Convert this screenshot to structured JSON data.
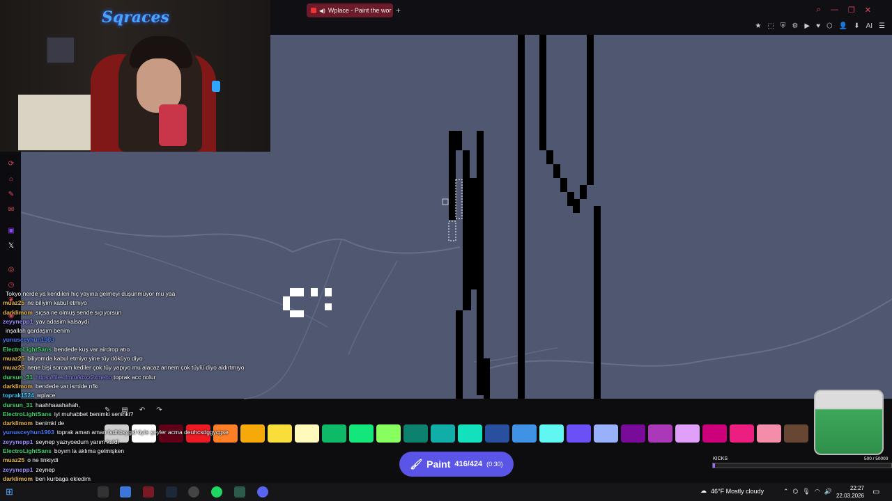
{
  "browser": {
    "tab_title": "Wplace - Paint the wor",
    "new_tab": "+",
    "window_controls": [
      "⌕",
      "—",
      "❐",
      "✕"
    ],
    "toolbar_icons": [
      "★",
      "⬚",
      "⛨",
      "⚙",
      "▶",
      "♥",
      "⬡",
      "👤",
      "⬇",
      "AI",
      "☰"
    ]
  },
  "webcam": {
    "logo_text": "Sqraces"
  },
  "chat": {
    "messages": [
      {
        "user": "",
        "text": "Tokyo nerde ya kendileri hiç yayına gelmeyi düşünmüyor mu yaa",
        "user_color": "#e04b5b"
      },
      {
        "user": "muaz25",
        "text": "ne biliyim kabul etmiyo",
        "user_color": "#e8b84a"
      },
      {
        "user": "darklimom",
        "text": "sıçsa ne olmuş sende sıçıyorsun",
        "user_color": "#e8b84a"
      },
      {
        "user": "zeyynepp1",
        "text": "yav adasim kalsaydi",
        "user_color": "#9b8cff"
      },
      {
        "user": "",
        "text": "inşallah gardaşım benim",
        "user_color": "#e04b5b"
      },
      {
        "user": "yunusceyhun1903",
        "text": "",
        "user_color": "#4a7dff"
      },
      {
        "user": "ElectroLightSans",
        "text": "bendede kuş var airdrop atıo",
        "user_color": "#3cd66a"
      },
      {
        "user": "muaz25",
        "text": "biliyomda kabul etmiyo yine tüy döküyo diyo",
        "user_color": "#e8b84a"
      },
      {
        "user": "muaz25",
        "text": "nene bişi sorcam kediler çok tüy yapıyo mu alacaz annem çok tüylü diyo aldırtmıyo",
        "user_color": "#e8b84a"
      },
      {
        "user": "dursun_31",
        "text": "toprak acc nolur",
        "link": "https://files.fm/u/kbxz2xmeho",
        "user_color": "#3cd66a"
      },
      {
        "user": "darklimom",
        "text": "bendede var ismide rıfkı",
        "user_color": "#e8b84a"
      },
      {
        "user": "toprak1524",
        "text": "wplace",
        "user_color": "#3cc8ff"
      },
      {
        "user": "dursun_31",
        "text": "haahhaaahahah,",
        "user_color": "#3cd66a"
      },
      {
        "user": "ElectroLightSans",
        "text": "iyi muhabbet benimki seninki?",
        "user_color": "#3cd66a"
      },
      {
        "user": "darklimom",
        "text": "benimki de",
        "user_color": "#e8b84a"
      },
      {
        "user": "yunusceyhun1903",
        "text": "toprak aman aman fsdhbsygsf öyle şeyler acma deuhcsdggycgse",
        "user_color": "#4a7dff"
      },
      {
        "user": "zeyynepp1",
        "text": "seynep yazıyoedum yarım kaldi",
        "user_color": "#9b8cff"
      },
      {
        "user": "ElectroLightSans",
        "text": "boyım la aklıma gelmişken",
        "user_color": "#3cd66a"
      },
      {
        "user": "muaz25",
        "text": "o ne linkiydi",
        "user_color": "#e8b84a"
      },
      {
        "user": "zeyynepp1",
        "text": "zeynep",
        "user_color": "#9b8cff"
      },
      {
        "user": "darklimom",
        "text": "ben kurbaga ekledim",
        "user_color": "#e8b84a"
      }
    ]
  },
  "paint_tools": [
    "✎",
    "▤",
    "↶",
    "↷"
  ],
  "palette": {
    "colors": [
      "#cfcfcf",
      "#ffffff",
      "#600018",
      "#ed1c24",
      "#ff7f27",
      "#f6aa09",
      "#f9dd3b",
      "#fffabc",
      "#0eb968",
      "#13e67b",
      "#87ff5e",
      "#0c816e",
      "#10aea6",
      "#13e1be",
      "#28509e",
      "#4093e4",
      "#60f7f2",
      "#6b50f6",
      "#99b1fb",
      "#780c99",
      "#aa38b9",
      "#e09ff9",
      "#cb007a",
      "#ec1f80",
      "#f38da9",
      "#684634"
    ]
  },
  "paint_button": {
    "label": "Paint",
    "count": "416/424",
    "timer": "(0:30)"
  },
  "kicks": {
    "label": "KICKS",
    "count": "500 / 50000",
    "progress": 0.01
  },
  "taskbar": {
    "weather": "46°F  Mostly cloudy",
    "time": "22:27",
    "date": "22.03.2026"
  }
}
